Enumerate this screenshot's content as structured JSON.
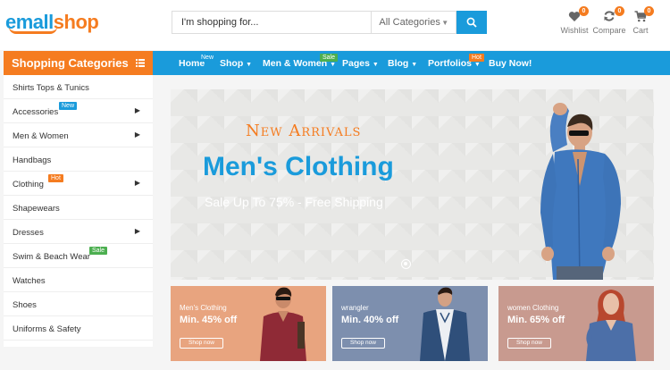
{
  "header": {
    "logo_part1": "emall",
    "logo_part2": "shop",
    "search_placeholder": "I'm shopping for...",
    "search_category": "All Categories",
    "icons": [
      {
        "label": "Wishlist",
        "count": "0",
        "icon": "heart-icon"
      },
      {
        "label": "Compare",
        "count": "0",
        "icon": "refresh-icon"
      },
      {
        "label": "Cart",
        "count": "0",
        "icon": "cart-icon"
      }
    ]
  },
  "nav": {
    "categories_title": "Shopping Categories",
    "items": [
      {
        "label": "Home",
        "tag": "New"
      },
      {
        "label": "Shop",
        "tag": ""
      },
      {
        "label": "Men & Women",
        "tag": "Sale"
      },
      {
        "label": "Pages",
        "tag": ""
      },
      {
        "label": "Blog",
        "tag": ""
      },
      {
        "label": "Portfolios",
        "tag": "Hot"
      },
      {
        "label": "Buy Now!",
        "tag": ""
      }
    ]
  },
  "sidebar": {
    "items": [
      {
        "label": "Shirts Tops & Tunics",
        "tag": "",
        "has_arrow": false
      },
      {
        "label": "Accessories",
        "tag": "New",
        "has_arrow": true
      },
      {
        "label": "Men & Women",
        "tag": "",
        "has_arrow": true
      },
      {
        "label": "Handbags",
        "tag": "",
        "has_arrow": false
      },
      {
        "label": "Clothing",
        "tag": "Hot",
        "has_arrow": true
      },
      {
        "label": "Shapewears",
        "tag": "",
        "has_arrow": false
      },
      {
        "label": "Dresses",
        "tag": "",
        "has_arrow": true
      },
      {
        "label": "Swim & Beach Wear",
        "tag": "Sale",
        "has_arrow": false
      },
      {
        "label": "Watches",
        "tag": "",
        "has_arrow": false
      },
      {
        "label": "Shoes",
        "tag": "",
        "has_arrow": false
      },
      {
        "label": "Uniforms & Safety",
        "tag": "",
        "has_arrow": false
      }
    ]
  },
  "hero": {
    "subtitle": "New Arrivals",
    "title": "Men's Clothing",
    "shipping": "Sale Up To 75% - Free Shipping"
  },
  "promos": [
    {
      "tag": "Men's Clothing",
      "discount": "Min. 45% off",
      "button": "Shop now",
      "color": "#e8a47f"
    },
    {
      "tag": "wrangler",
      "discount": "Min. 40% off",
      "button": "Shop now",
      "color": "#7d8fae"
    },
    {
      "tag": "women Clothing",
      "discount": "Min. 65% off",
      "button": "Shop now",
      "color": "#c89a8f"
    }
  ],
  "colors": {
    "brand_blue": "#1a9bdb",
    "brand_orange": "#f57c20",
    "tag_green": "#4caf50"
  }
}
